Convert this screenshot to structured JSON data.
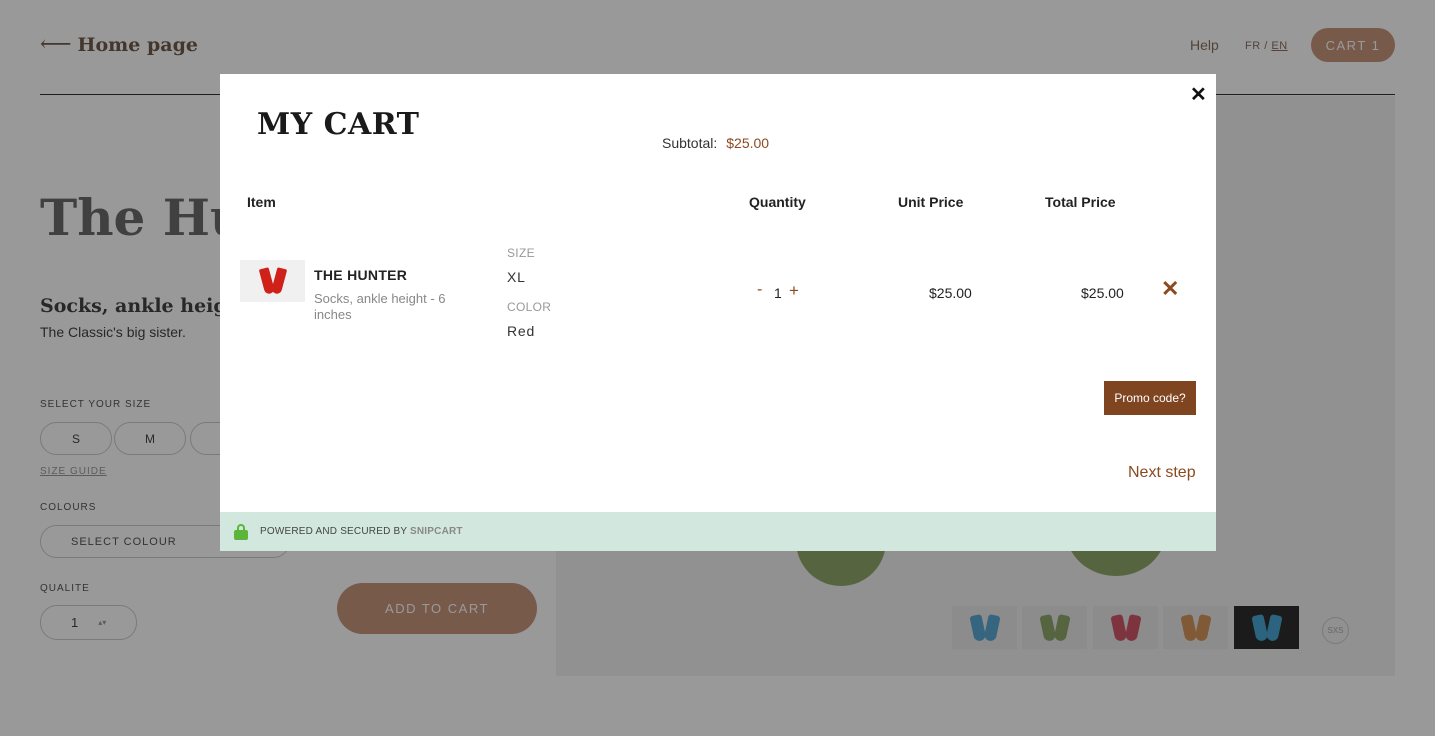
{
  "background_page": {
    "back_link": "Home page",
    "nav": {
      "help": "Help",
      "lang_fr": "FR",
      "lang_sep": "/",
      "lang_en": "EN",
      "cart_button": "CART 1"
    },
    "product_title_visible": "The Hun",
    "product_subtitle_visible": "Socks, ankle height -",
    "tagline": "The Classic's big sister.",
    "select_size_label": "SELECT YOUR SIZE",
    "sizes_visible": [
      "S",
      "M"
    ],
    "size_guide": "SIZE GUIDE",
    "colours_label": "COLOURS",
    "colour_select_placeholder": "SELECT COLOUR",
    "quality_label": "QUALITE",
    "quantity_value": "1",
    "add_to_cart": "ADD TO CART",
    "thumbnail_colors": [
      "#5aa9d6",
      "#8fa86a",
      "#d0586a",
      "#d6955a",
      "#4aa7d4"
    ],
    "logo_text": "SXS"
  },
  "modal": {
    "title": "MY CART",
    "subtotal_label": "Subtotal:",
    "subtotal_value": "$25.00",
    "columns": {
      "item": "Item",
      "quantity": "Quantity",
      "unit_price": "Unit Price",
      "total_price": "Total Price"
    },
    "item": {
      "name": "THE HUNTER",
      "description": "Socks, ankle height - 6 inches",
      "size_label": "SIZE",
      "size_value": "XL",
      "color_label": "COLOR",
      "color_value": "Red",
      "quantity": "1",
      "minus": "-",
      "plus": "+",
      "unit_price": "$25.00",
      "total_price": "$25.00",
      "remove_icon": "✕",
      "image_color": "#d0201a"
    },
    "promo_button": "Promo code?",
    "next_step": "Next step",
    "close_icon": "✕",
    "footer": {
      "powered_text": "POWERED AND SECURED BY",
      "brand": "SNIPCART"
    }
  },
  "colors": {
    "accent": "#8b4a1f",
    "promo_bg": "#7f4520",
    "footer_bg": "#d2e8df",
    "lock": "#5cb53b"
  }
}
